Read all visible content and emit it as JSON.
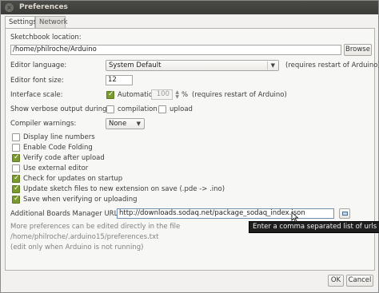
{
  "window": {
    "title": "Preferences"
  },
  "tabs": [
    {
      "label": "Settings",
      "active": true
    },
    {
      "label": "Network",
      "active": false
    }
  ],
  "sketchbook": {
    "label": "Sketchbook location:",
    "value": "/home/philroche/Arduino",
    "browse_label": "Browse"
  },
  "editor_language": {
    "label": "Editor language:",
    "value": "System Default",
    "note": "(requires restart of Arduino)"
  },
  "font_size": {
    "label": "Editor font size:",
    "value": "12"
  },
  "interface_scale": {
    "label": "Interface scale:",
    "automatic_label": "Automatic",
    "automatic_checked": true,
    "value": "100",
    "unit": "%",
    "note": "(requires restart of Arduino)"
  },
  "verbose": {
    "label": "Show verbose output during:",
    "compilation_label": "compilation",
    "compilation_checked": false,
    "upload_label": "upload",
    "upload_checked": false
  },
  "compiler_warnings": {
    "label": "Compiler warnings:",
    "value": "None"
  },
  "options": [
    {
      "label": "Display line numbers",
      "checked": false
    },
    {
      "label": "Enable Code Folding",
      "checked": false
    },
    {
      "label": "Verify code after upload",
      "checked": true
    },
    {
      "label": "Use external editor",
      "checked": false
    },
    {
      "label": "Check for updates on startup",
      "checked": true
    },
    {
      "label": "Update sketch files to new extension on save (.pde -> .ino)",
      "checked": true
    },
    {
      "label": "Save when verifying or uploading",
      "checked": true
    }
  ],
  "boards_manager": {
    "label": "Additional Boards Manager URLs:",
    "value": "http://downloads.sodaq.net/package_sodaq_index.json",
    "tooltip": "Enter a comma separated list of urls"
  },
  "footer": {
    "line1": "More preferences can be edited directly in the file",
    "line2": "/home/philroche/.arduino15/preferences.txt",
    "line3": "(edit only when Arduino is not running)"
  },
  "buttons": {
    "ok": "OK",
    "cancel": "Cancel"
  },
  "colors": {
    "checkbox_on": "#7a9a2e",
    "titlebar": "#3b3b37",
    "tooltip_bg": "#1e1e1e"
  }
}
